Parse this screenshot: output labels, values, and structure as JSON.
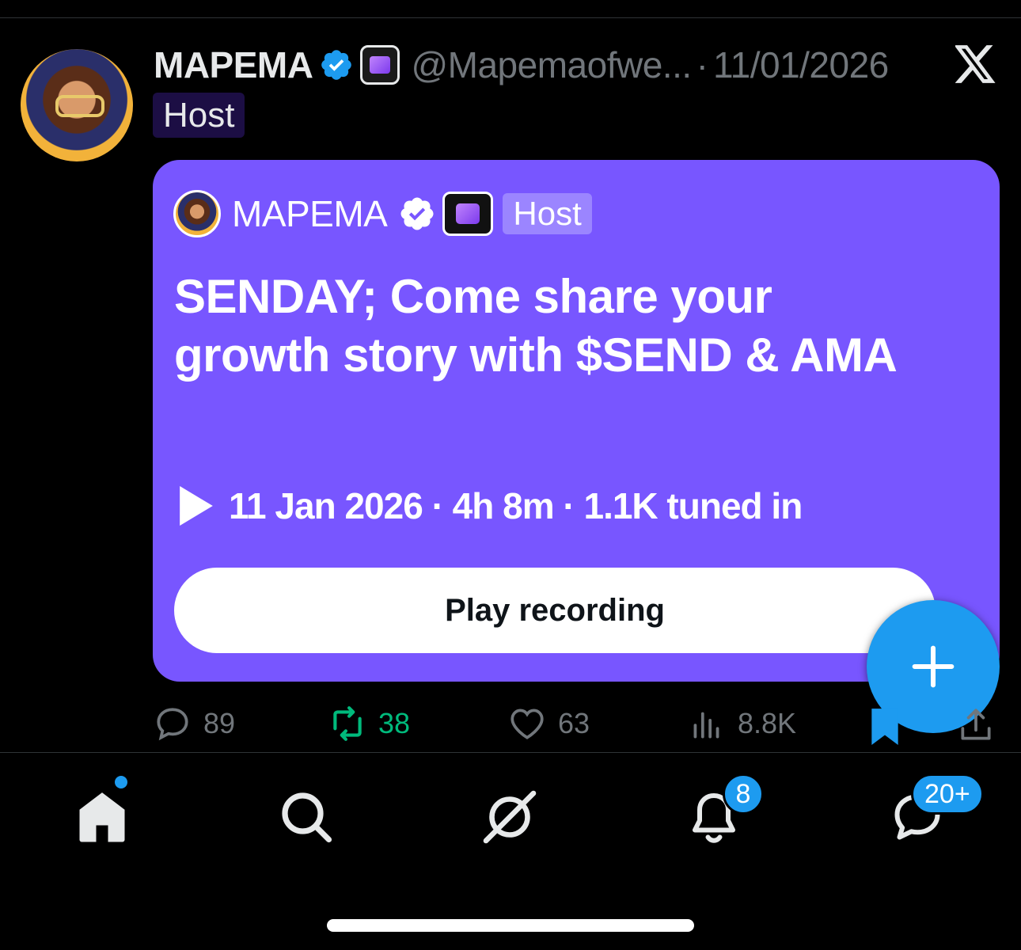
{
  "post": {
    "author_name": "MAPEMA",
    "handle": "@Mapemaofwe...",
    "separator": "·",
    "date": "11/01/2026",
    "role_tag": "Host"
  },
  "space_card": {
    "host_name": "MAPEMA",
    "role_tag": "Host",
    "title": "SENDAY; Come share your growth story with $SEND & AMA",
    "meta": "11 Jan 2026 · 4h 8m · 1.1K tuned in",
    "play_button_label": "Play recording",
    "background_color": "#7856ff"
  },
  "actions": {
    "replies": "89",
    "reposts": "38",
    "likes": "63",
    "views": "8.8K"
  },
  "tabbar": {
    "notifications_badge": "8",
    "messages_badge": "20+"
  },
  "colors": {
    "accent": "#1d9bf0",
    "repost_green": "#00ba7c",
    "muted": "#71767b"
  },
  "icons": {
    "verified": "verified-badge-icon",
    "app": "app-badge-icon",
    "x_logo": "x-logo-icon",
    "play": "play-icon",
    "compose": "plus-icon",
    "reply": "reply-icon",
    "repost": "repost-icon",
    "like": "heart-icon",
    "views": "views-icon",
    "bookmark": "bookmark-icon",
    "share": "share-icon",
    "home": "home-icon",
    "search": "search-icon",
    "grok": "grok-icon",
    "notifications": "bell-icon",
    "messages": "messages-icon"
  }
}
